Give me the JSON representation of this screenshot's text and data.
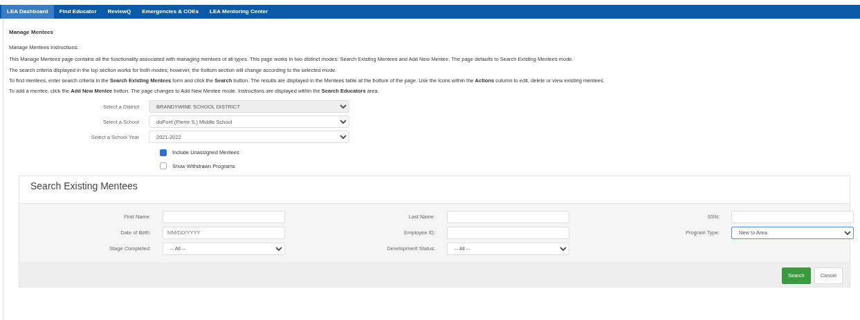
{
  "nav": [
    {
      "label": "LEA Dashboard",
      "selected": true
    },
    {
      "label": "Find Educator",
      "selected": false
    },
    {
      "label": "ReviewQ",
      "selected": false
    },
    {
      "label": "Emergencies & COEs",
      "selected": false
    },
    {
      "label": "LEA Mentoring Center",
      "selected": false
    }
  ],
  "title": "Manage Mentees",
  "instructions_heading": "Manage Mentees Instructions:",
  "instructions": [
    "This Manage Mentees page contains all the functionality associated with managing mentees of all types. This page works in two distinct modes: Search Existing Mentees and Add New Mentee. The page defaults to Search Existing Mentees mode.",
    "The search criteria displayed in the top section works for both modes; however, the bottom section will change according to the selected mode.",
    "To find mentees, enter search criteria in the **Search Existing Mentees** form and click the **Search** button. The results are displayed in the Mentees table at the bottom of the page. Use the icons within the **Actions** column to edit, delete or view existing mentees.",
    "To add a mentee, click the **Add New Mentee** button. The page changes to Add New Mentee mode. Instructions are displayed within the **Search Educators** area."
  ],
  "filters": [
    {
      "label": "Select a District",
      "value": "BRANDYWINE SCHOOL DISTRICT",
      "disabled": true
    },
    {
      "label": "Select a School",
      "value": "duPont (Pierre S.) Middle School",
      "disabled": false
    },
    {
      "label": "Select a School Year",
      "value": "2021-2022",
      "disabled": false
    }
  ],
  "checkboxes": [
    {
      "label": "Include Unassigned Mentees",
      "checked": true
    },
    {
      "label": "Show Withdrawn Programs",
      "checked": false
    }
  ],
  "search": {
    "legend": "Search Existing Mentees",
    "fields": [
      {
        "label": "First Name:",
        "kind": "text"
      },
      {
        "label": "Last Name:",
        "kind": "text"
      },
      {
        "label": "SSN:",
        "kind": "text"
      },
      {
        "label": "Date of Birth:",
        "kind": "text",
        "placeholder": "MM/DD/YYYY"
      },
      {
        "label": "Employee ID:",
        "kind": "text"
      },
      {
        "label": "Program Type:",
        "kind": "select",
        "value": "New to Area"
      },
      {
        "label": "Stage Completed:",
        "kind": "select",
        "value": "-- All --"
      },
      {
        "label": "Development Status:",
        "kind": "select",
        "value": "-- All --"
      }
    ],
    "buttons": [
      {
        "label": "Search",
        "kind": "primary"
      },
      {
        "label": "Cancel",
        "kind": "secondary"
      }
    ]
  }
}
